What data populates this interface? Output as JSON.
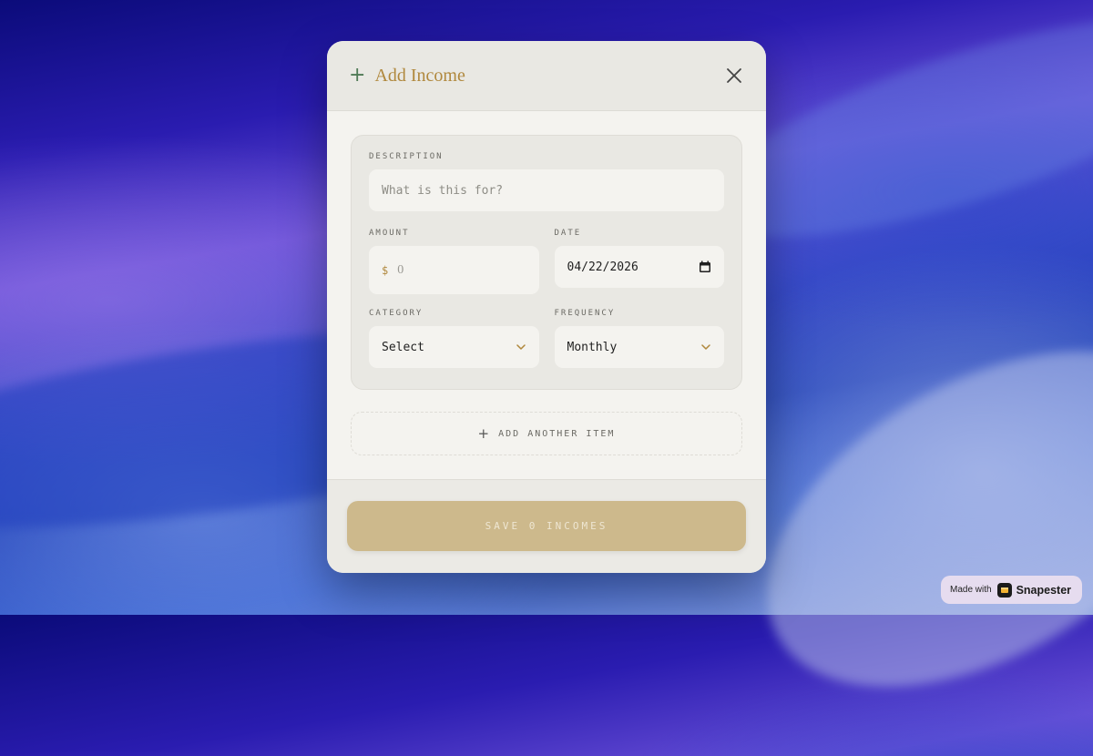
{
  "modal": {
    "title": "Add Income",
    "description": {
      "label": "DESCRIPTION",
      "placeholder": "What is this for?"
    },
    "amount": {
      "label": "AMOUNT",
      "currency_symbol": "$",
      "placeholder": "0"
    },
    "date": {
      "label": "DATE",
      "value": "04/22/2026"
    },
    "category": {
      "label": "CATEGORY",
      "value": "Select"
    },
    "frequency": {
      "label": "FREQUENCY",
      "value": "Monthly"
    },
    "add_item_label": "ADD ANOTHER ITEM",
    "save_label": "SAVE 0 INCOMES"
  },
  "badge": {
    "made_with": "Made with",
    "brand": "Snapester"
  },
  "colors": {
    "accent_gold": "#b0883d",
    "save_button": "#cdb98c",
    "plus_green": "#4f7a55"
  },
  "icons": [
    "plus-icon",
    "close-icon",
    "calendar-icon",
    "chevron-down-icon",
    "snapester-logo-icon"
  ]
}
